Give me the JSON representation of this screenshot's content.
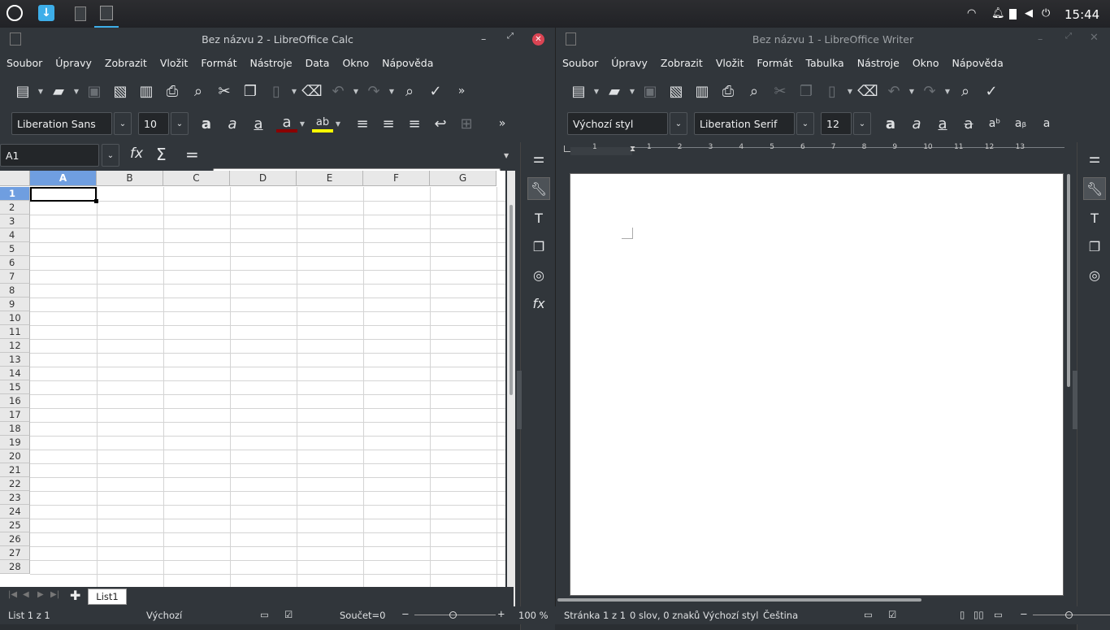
{
  "taskbar": {
    "clock": "15:44"
  },
  "calc": {
    "title": "Bez názvu 2 - LibreOffice Calc",
    "menu": [
      "Soubor",
      "Úpravy",
      "Zobrazit",
      "Vložit",
      "Formát",
      "Nástroje",
      "Data",
      "Okno",
      "Nápověda"
    ],
    "font_name": "Liberation Sans",
    "font_size": "10",
    "name_box": "A1",
    "formula": "",
    "columns": [
      "A",
      "B",
      "C",
      "D",
      "E",
      "F",
      "G"
    ],
    "rows": [
      "1",
      "2",
      "3",
      "4",
      "5",
      "6",
      "7",
      "8",
      "9",
      "10",
      "11",
      "12",
      "13",
      "14",
      "15",
      "16",
      "17",
      "18",
      "19",
      "20",
      "21",
      "22",
      "23",
      "24",
      "25",
      "26",
      "27",
      "28"
    ],
    "sheet_tab": "List1",
    "status": {
      "sheet": "List 1 z 1",
      "style": "Výchozí",
      "sum": "Součet=0",
      "zoom": "100 %"
    }
  },
  "writer": {
    "title": "Bez názvu 1 - LibreOffice Writer",
    "menu": [
      "Soubor",
      "Úpravy",
      "Zobrazit",
      "Vložit",
      "Formát",
      "Tabulka",
      "Nástroje",
      "Okno",
      "Nápověda"
    ],
    "para_style": "Výchozí styl",
    "font_name": "Liberation Serif",
    "font_size": "12",
    "ruler": [
      "1",
      "1",
      "2",
      "3",
      "4",
      "5",
      "6",
      "7",
      "8",
      "9",
      "10",
      "11",
      "12",
      "13"
    ],
    "status": {
      "page": "Stránka 1 z 1",
      "words": "0 slov, 0 znaků",
      "style": "Výchozí styl",
      "lang": "Čeština"
    }
  },
  "colors": {
    "accent": "#3daee9",
    "selection": "#6f9ee0",
    "close": "#da4453"
  }
}
